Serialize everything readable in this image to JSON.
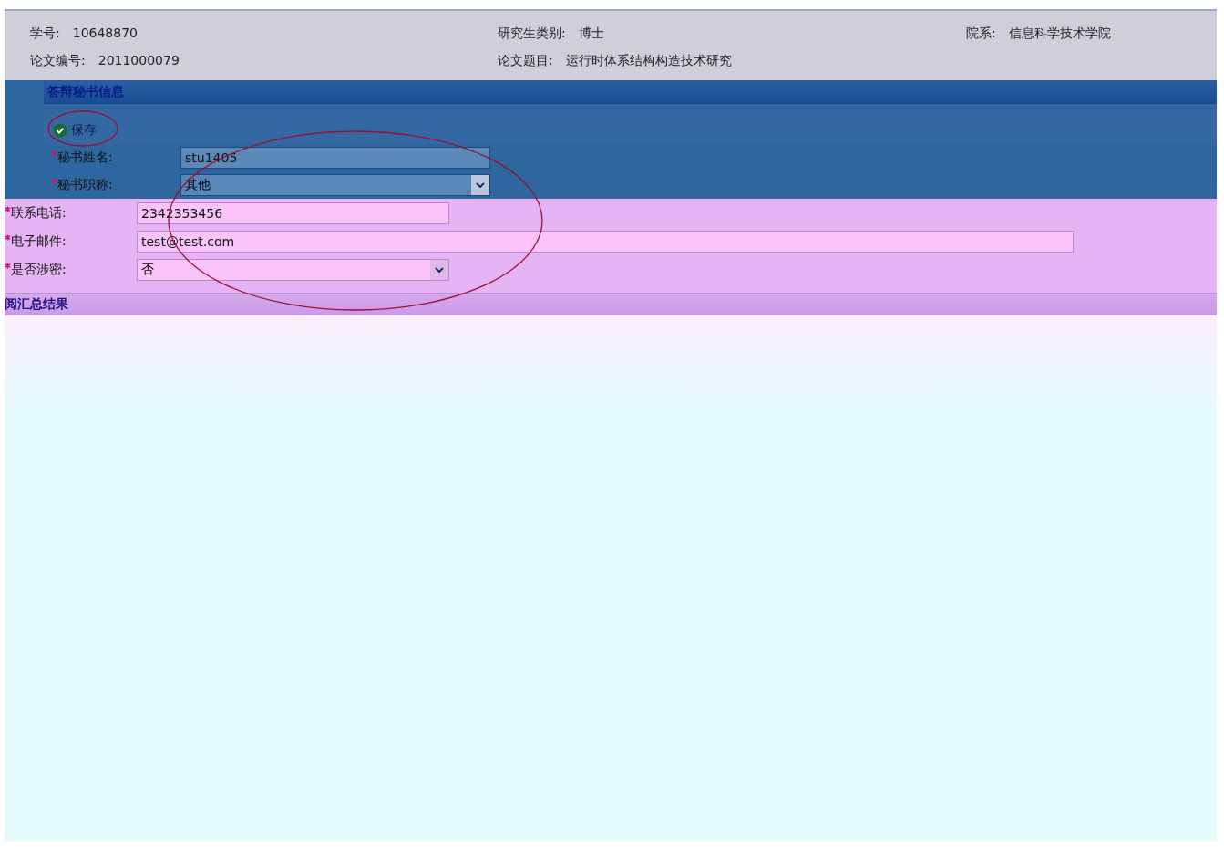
{
  "info": [
    {
      "label": "学号:",
      "value": "10648870"
    },
    {
      "label": "研究生类别:",
      "value": "博士"
    },
    {
      "label": "院系:",
      "value": "信息科学技术学院"
    },
    {
      "label": "论文编号:",
      "value": "2011000079"
    },
    {
      "label": "论文题目:",
      "value": "运行时体系结构构造技术研究"
    }
  ],
  "secretary_section": {
    "title": "答辩秘书信息",
    "save_button": "保存"
  },
  "fields": [
    {
      "label": "秘书姓名:",
      "kind": "input",
      "value": "stu1405",
      "required": true
    },
    {
      "label": "秘书职称:",
      "kind": "select",
      "value": "其他",
      "required": true
    },
    {
      "label": "联系电话:",
      "kind": "input",
      "value": "2342353456",
      "required": true
    },
    {
      "label": "电子邮件:",
      "kind": "wide-input",
      "value": "test@test.com",
      "required": true
    },
    {
      "label": "是否涉密:",
      "kind": "select",
      "value": "否",
      "required": true
    }
  ],
  "summary_section": {
    "title": "阅汇总结果"
  }
}
